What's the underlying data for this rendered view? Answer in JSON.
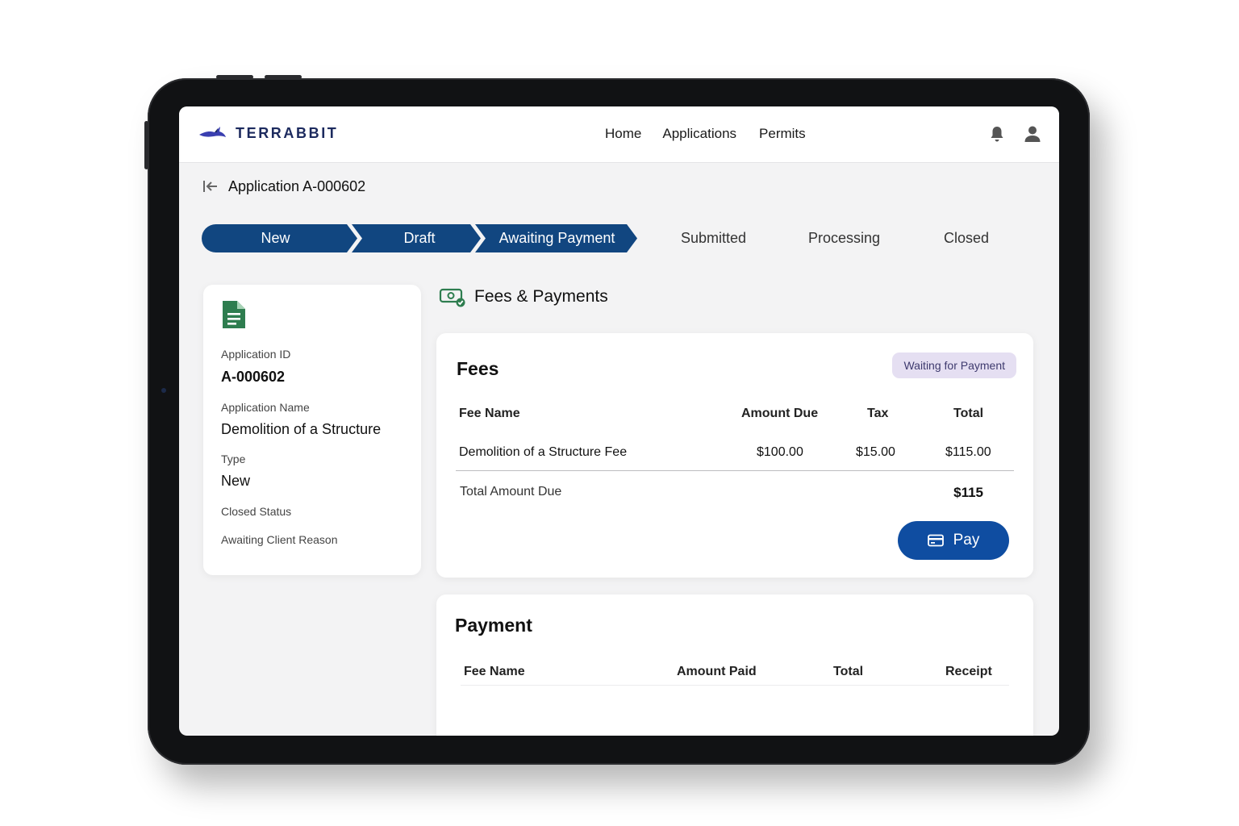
{
  "brand": {
    "name": "TERRABBIT",
    "color": "#1c2a5e",
    "accent": "#3a3fb0"
  },
  "nav": {
    "links": [
      "Home",
      "Applications",
      "Permits"
    ],
    "icons": [
      "bell-icon",
      "user-icon"
    ]
  },
  "page": {
    "title": "Application A-000602",
    "back_icon": "back-arrow-icon"
  },
  "stepper": {
    "active_color": "#114680",
    "steps": [
      {
        "label": "New",
        "state": "complete"
      },
      {
        "label": "Draft",
        "state": "complete"
      },
      {
        "label": "Awaiting Payment",
        "state": "current"
      },
      {
        "label": "Submitted",
        "state": "pending"
      },
      {
        "label": "Processing",
        "state": "pending"
      },
      {
        "label": "Closed",
        "state": "pending"
      }
    ]
  },
  "info": {
    "icon": "document-icon",
    "fields": [
      {
        "label": "Application ID",
        "value": "A-000602"
      },
      {
        "label": "Application Name",
        "value": "Demolition of a Structure"
      },
      {
        "label": "Type",
        "value": "New"
      },
      {
        "label": "Closed Status",
        "value": ""
      },
      {
        "label": "Awaiting Client Reason",
        "value": ""
      }
    ]
  },
  "section": {
    "title": "Fees & Payments",
    "icon": "money-icon"
  },
  "fees": {
    "title": "Fees",
    "status_badge": "Waiting for Payment",
    "columns": [
      "Fee Name",
      "Amount Due",
      "Tax",
      "Total"
    ],
    "rows": [
      {
        "fee_name": "Demolition of a Structure Fee",
        "amount_due": "$100.00",
        "tax": "$15.00",
        "total": "$115.00"
      }
    ],
    "total_label": "Total Amount Due",
    "total_value": "$115",
    "pay_button": "Pay"
  },
  "payment": {
    "title": "Payment",
    "columns": [
      "Fee Name",
      "Amount Paid",
      "Total",
      "Receipt"
    ]
  }
}
